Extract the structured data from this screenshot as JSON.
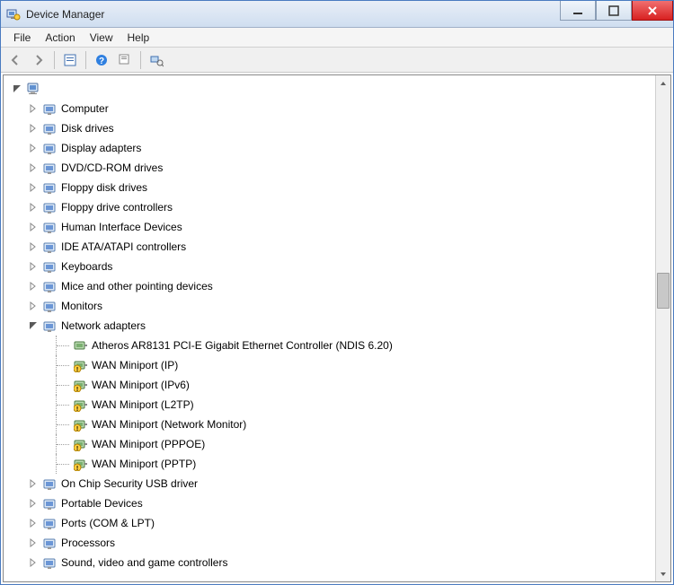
{
  "window": {
    "title": "Device Manager"
  },
  "menu": {
    "file": "File",
    "action": "Action",
    "view": "View",
    "help": "Help"
  },
  "tree": {
    "root": "",
    "categories": [
      {
        "label": "Computer",
        "expanded": false
      },
      {
        "label": "Disk drives",
        "expanded": false
      },
      {
        "label": "Display adapters",
        "expanded": false
      },
      {
        "label": "DVD/CD-ROM drives",
        "expanded": false
      },
      {
        "label": "Floppy disk drives",
        "expanded": false
      },
      {
        "label": "Floppy drive controllers",
        "expanded": false
      },
      {
        "label": "Human Interface Devices",
        "expanded": false
      },
      {
        "label": "IDE ATA/ATAPI controllers",
        "expanded": false
      },
      {
        "label": "Keyboards",
        "expanded": false
      },
      {
        "label": "Mice and other pointing devices",
        "expanded": false
      },
      {
        "label": "Monitors",
        "expanded": false
      },
      {
        "label": "Network adapters",
        "expanded": true,
        "children": [
          {
            "label": "Atheros AR8131 PCI-E Gigabit Ethernet Controller (NDIS 6.20)",
            "warn": false
          },
          {
            "label": "WAN Miniport (IP)",
            "warn": true
          },
          {
            "label": "WAN Miniport (IPv6)",
            "warn": true
          },
          {
            "label": "WAN Miniport (L2TP)",
            "warn": true
          },
          {
            "label": "WAN Miniport (Network Monitor)",
            "warn": true
          },
          {
            "label": "WAN Miniport (PPPOE)",
            "warn": true
          },
          {
            "label": "WAN Miniport (PPTP)",
            "warn": true
          }
        ]
      },
      {
        "label": "On Chip Security USB driver",
        "expanded": false
      },
      {
        "label": "Portable Devices",
        "expanded": false
      },
      {
        "label": "Ports (COM & LPT)",
        "expanded": false
      },
      {
        "label": "Processors",
        "expanded": false
      },
      {
        "label": "Sound, video and game controllers",
        "expanded": false
      }
    ]
  }
}
